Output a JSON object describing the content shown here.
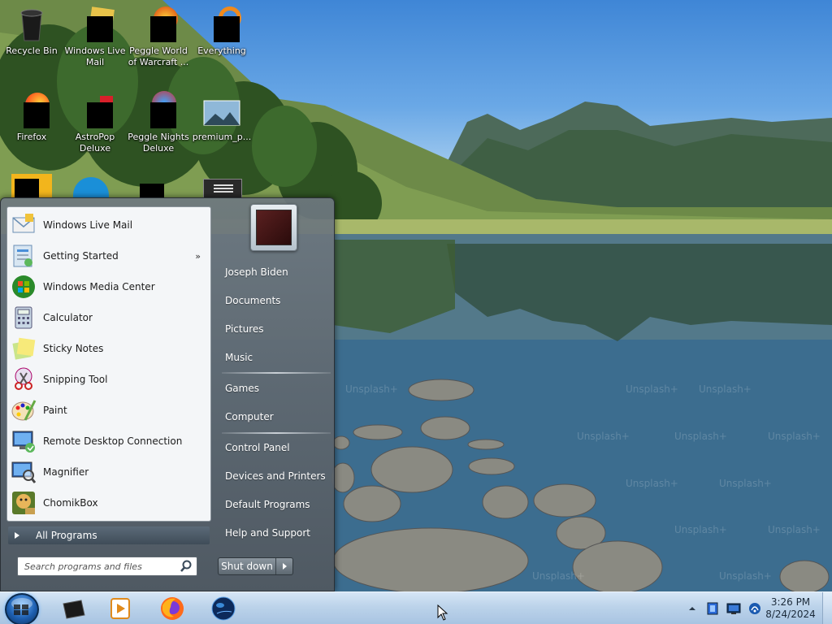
{
  "desktop": {
    "icons": [
      {
        "label": "Recycle Bin",
        "icon": "recycle-bin-icon"
      },
      {
        "label": "Windows Live Mail",
        "icon": "mail-icon"
      },
      {
        "label": "Peggle World of Warcraft ...",
        "icon": "game-icon"
      },
      {
        "label": "Everything",
        "icon": "search-app-icon"
      },
      {
        "label": "Firefox",
        "icon": "firefox-icon"
      },
      {
        "label": "AstroPop Deluxe",
        "icon": "game-icon"
      },
      {
        "label": "Peggle Nights Deluxe",
        "icon": "game-icon"
      },
      {
        "label": "premium_p...",
        "icon": "image-file-icon"
      }
    ],
    "watermark": "Unsplash+"
  },
  "start_menu": {
    "programs": [
      {
        "label": "Windows Live Mail",
        "icon": "mail-icon"
      },
      {
        "label": "Getting Started",
        "icon": "getting-started-icon",
        "has_submenu": true,
        "submenu_glyph": "»"
      },
      {
        "label": "Windows Media Center",
        "icon": "media-center-icon"
      },
      {
        "label": "Calculator",
        "icon": "calculator-icon"
      },
      {
        "label": "Sticky Notes",
        "icon": "sticky-notes-icon"
      },
      {
        "label": "Snipping Tool",
        "icon": "scissors-icon"
      },
      {
        "label": "Paint",
        "icon": "paint-palette-icon"
      },
      {
        "label": "Remote Desktop Connection",
        "icon": "remote-desktop-icon"
      },
      {
        "label": "Magnifier",
        "icon": "magnifier-icon"
      },
      {
        "label": "ChomikBox",
        "icon": "chomikbox-icon"
      }
    ],
    "all_programs": "All Programs",
    "search_placeholder": "Search programs and files",
    "right_links": [
      {
        "label": "Joseph Biden",
        "group": 1
      },
      {
        "label": "Documents",
        "group": 1
      },
      {
        "label": "Pictures",
        "group": 1
      },
      {
        "label": "Music",
        "group": 1
      },
      {
        "label": "Games",
        "group": 2
      },
      {
        "label": "Computer",
        "group": 2
      },
      {
        "label": "Control Panel",
        "group": 3
      },
      {
        "label": "Devices and Printers",
        "group": 3
      },
      {
        "label": "Default Programs",
        "group": 3
      },
      {
        "label": "Help and Support",
        "group": 3
      }
    ],
    "shutdown_label": "Shut down"
  },
  "taskbar": {
    "pinned": [
      {
        "name": "black-app-icon"
      },
      {
        "name": "media-player-icon"
      },
      {
        "name": "firefox-icon"
      },
      {
        "name": "globe-icon"
      }
    ],
    "tray_icons": [
      "show-hidden-icons-icon",
      "blue-app-icon",
      "monitor-icon",
      "network-icon"
    ],
    "clock": {
      "time": "3:26 PM",
      "date": "8/24/2024"
    }
  },
  "colors": {
    "taskbar": "#bcd3ea",
    "start_menu": "#6e7880",
    "left_pane": "#f4f6f8"
  }
}
